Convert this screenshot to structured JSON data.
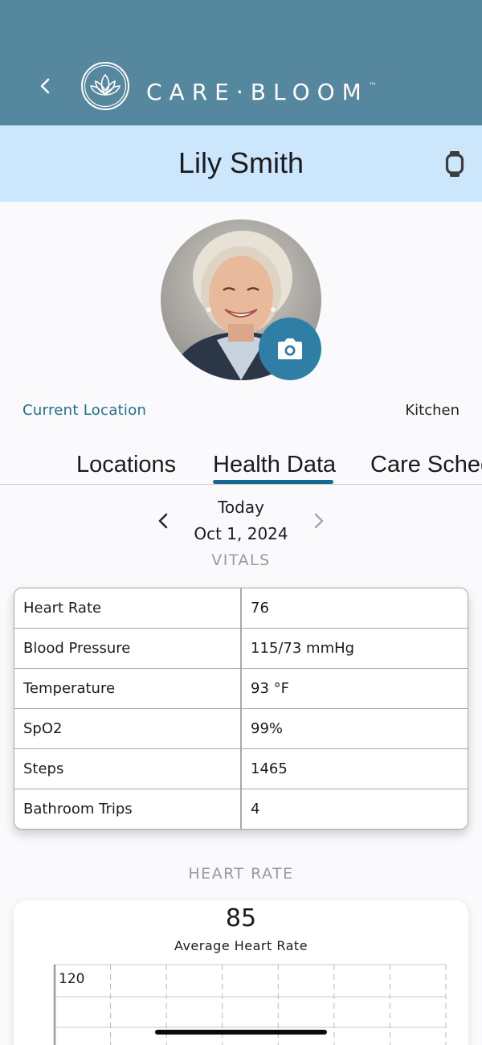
{
  "header": {
    "brand": "CARE·BLOOM",
    "trademark": "™",
    "back_icon": "chevron-left-icon",
    "logo_icon": "lotus-logo-icon",
    "bg_color": "#55879f"
  },
  "patient": {
    "name": "Lily Smith",
    "device_icon": "smartwatch-icon",
    "bar_color": "#cce6fb",
    "camera_icon": "camera-icon"
  },
  "location": {
    "label": "Current Location",
    "value": "Kitchen"
  },
  "tabs": [
    {
      "label": "Locations",
      "active": false
    },
    {
      "label": "Health Data",
      "active": true
    },
    {
      "label": "Care Schedule",
      "active": false
    }
  ],
  "date_nav": {
    "day": "Today",
    "date": "Oct 1, 2024"
  },
  "vitals": {
    "title": "VITALS",
    "rows": [
      {
        "label": "Heart Rate",
        "value": "76"
      },
      {
        "label": "Blood Pressure",
        "value": "115/73 mmHg"
      },
      {
        "label": "Temperature",
        "value": "93 °F"
      },
      {
        "label": "SpO2",
        "value": "99%"
      },
      {
        "label": "Steps",
        "value": "1465"
      },
      {
        "label": "Bathroom Trips",
        "value": "4"
      }
    ]
  },
  "heart_rate": {
    "title": "HEART RATE",
    "average": "85",
    "average_label": "Average Heart Rate"
  },
  "chart_data": {
    "type": "line",
    "title": "",
    "xlabel": "",
    "ylabel": "",
    "y_ticks": [
      "120"
    ],
    "grid": true,
    "series": []
  },
  "colors": {
    "accent": "#16688e",
    "camera_button": "#2f7ea6",
    "location_label": "#1f6f8e"
  }
}
